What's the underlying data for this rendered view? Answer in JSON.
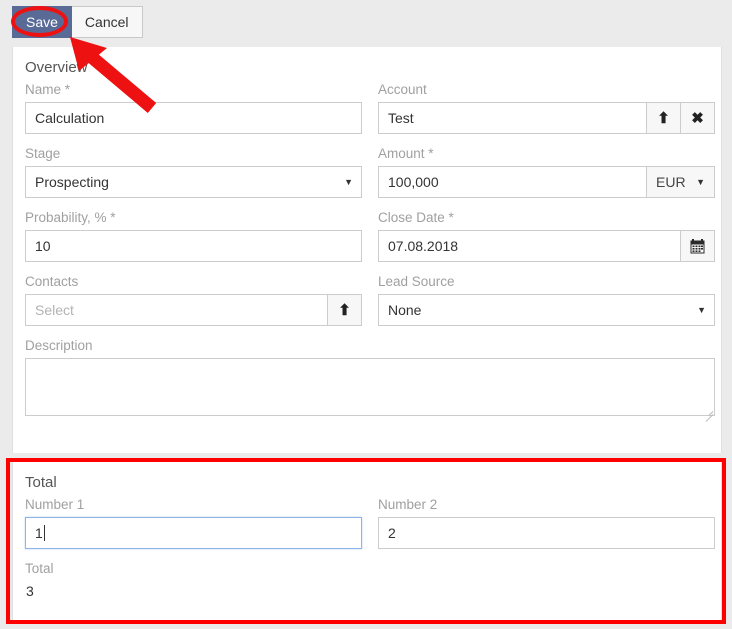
{
  "toolbar": {
    "save_label": "Save",
    "cancel_label": "Cancel"
  },
  "overview": {
    "section_title": "Overview",
    "fields": {
      "name": {
        "label": "Name *",
        "value": "Calculation"
      },
      "account": {
        "label": "Account",
        "value": "Test",
        "select_icon": "arrow-up-icon",
        "clear_icon": "close-x-icon"
      },
      "stage": {
        "label": "Stage",
        "value": "Prospecting",
        "dropdown_icon": "chevron-down-icon"
      },
      "amount": {
        "label": "Amount *",
        "value": "100,000",
        "currency": "EUR",
        "dropdown_icon": "chevron-down-icon"
      },
      "probability": {
        "label": "Probability, % *",
        "value": "10"
      },
      "close_date": {
        "label": "Close Date *",
        "value": "07.08.2018",
        "calendar_icon": "calendar-icon"
      },
      "contacts": {
        "label": "Contacts",
        "value": "",
        "placeholder": "Select",
        "select_icon": "arrow-up-icon"
      },
      "lead_source": {
        "label": "Lead Source",
        "value": "None",
        "dropdown_icon": "chevron-down-icon"
      },
      "description": {
        "label": "Description",
        "value": "",
        "placeholder": ""
      }
    }
  },
  "total_panel": {
    "section_title": "Total",
    "fields": {
      "number1": {
        "label": "Number 1",
        "value": "1",
        "focused": true
      },
      "number2": {
        "label": "Number 2",
        "value": "2"
      },
      "total": {
        "label": "Total",
        "value": "3"
      }
    }
  },
  "annotations": {
    "highlight_color": "#ff0000",
    "circle_target": "save-button",
    "rect_target": "total-panel"
  },
  "colors": {
    "primary_button": "#5a6a96",
    "page_background": "#ebebeb",
    "panel_background": "#ffffff",
    "label_text": "#a0a0a0",
    "focus_border": "#8cb4e8"
  }
}
